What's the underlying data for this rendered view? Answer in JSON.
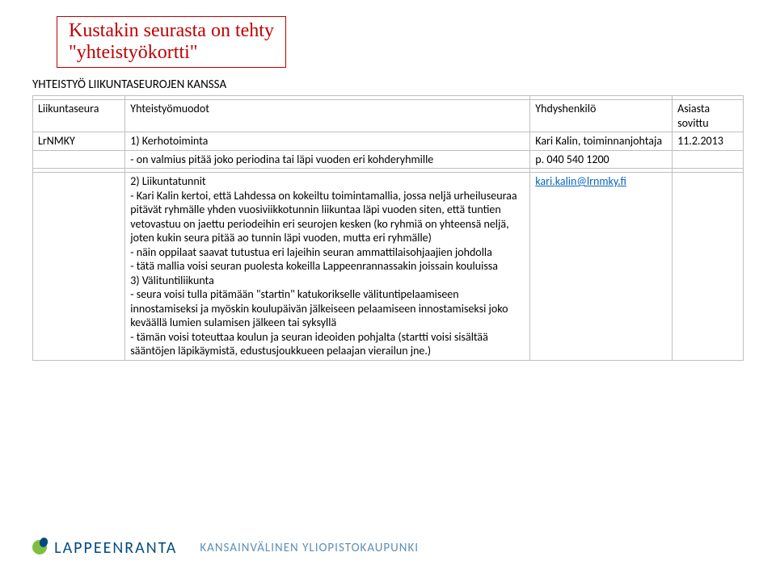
{
  "callout": {
    "line1": "Kustakin seurasta on tehty",
    "line2": "\"yhteistyökortti\""
  },
  "section_title": "YHTEISTYÖ LIIKUNTASEUROJEN KANSSA",
  "headers": {
    "col1": "Liikuntaseura",
    "col2": "Yhteistyömuodot",
    "col3": "Yhdyshenkilö",
    "col4": "Asiasta sovittu"
  },
  "row1": {
    "c1": "LrNMKY",
    "c2": "1)    Kerhotoiminta",
    "c3": "Kari Kalin, toiminnanjohtaja",
    "c4": "11.2.2013"
  },
  "row2": {
    "c2": "-    on valmius pitää joko periodina tai läpi vuoden eri kohderyhmille",
    "c3": "p. 040 540 1200"
  },
  "row3": {
    "c2_heading": "2)    Liikuntatunnit",
    "c2_b1": "-    Kari Kalin kertoi, että Lahdessa on kokeiltu toimintamallia, jossa neljä urheiluseuraa pitävät ryhmälle yhden vuosiviikkotunnin liikuntaa läpi vuoden siten, että tuntien vetovastuu on jaettu periodeihin eri seurojen kesken (ko ryhmiä on yhteensä neljä, joten kukin seura pitää ao tunnin läpi vuoden, mutta eri ryhmälle)",
    "c2_b2": "-    näin oppilaat saavat tutustua eri lajeihin seuran ammattilaisohjaajien johdolla",
    "c2_b3": "-    tätä mallia voisi seuran puolesta kokeilla Lappeenrannassakin joissain kouluissa",
    "c2_h2": "3)    Välituntiliikunta",
    "c2_b4": "-    seura voisi tulla pitämään \"startin\" katukorikselle välituntipelaamiseen innostamiseksi ja myöskin koulupäivän jälkeiseen pelaamiseen innostamiseksi joko keväällä lumien sulamisen jälkeen tai syksyllä",
    "c2_b5": "-    tämän voisi toteuttaa koulun ja seuran ideoiden pohjalta (startti voisi sisältää sääntöjen läpikäymistä, edustusjoukkueen pelaajan vierailun jne.)",
    "c3_link": "kari.kalin@lrnmky.fi"
  },
  "footer": {
    "brand": "LAPPEENRANTA",
    "tag": "KANSAINVÄLINEN YLIOPISTOKAUPUNKI"
  }
}
